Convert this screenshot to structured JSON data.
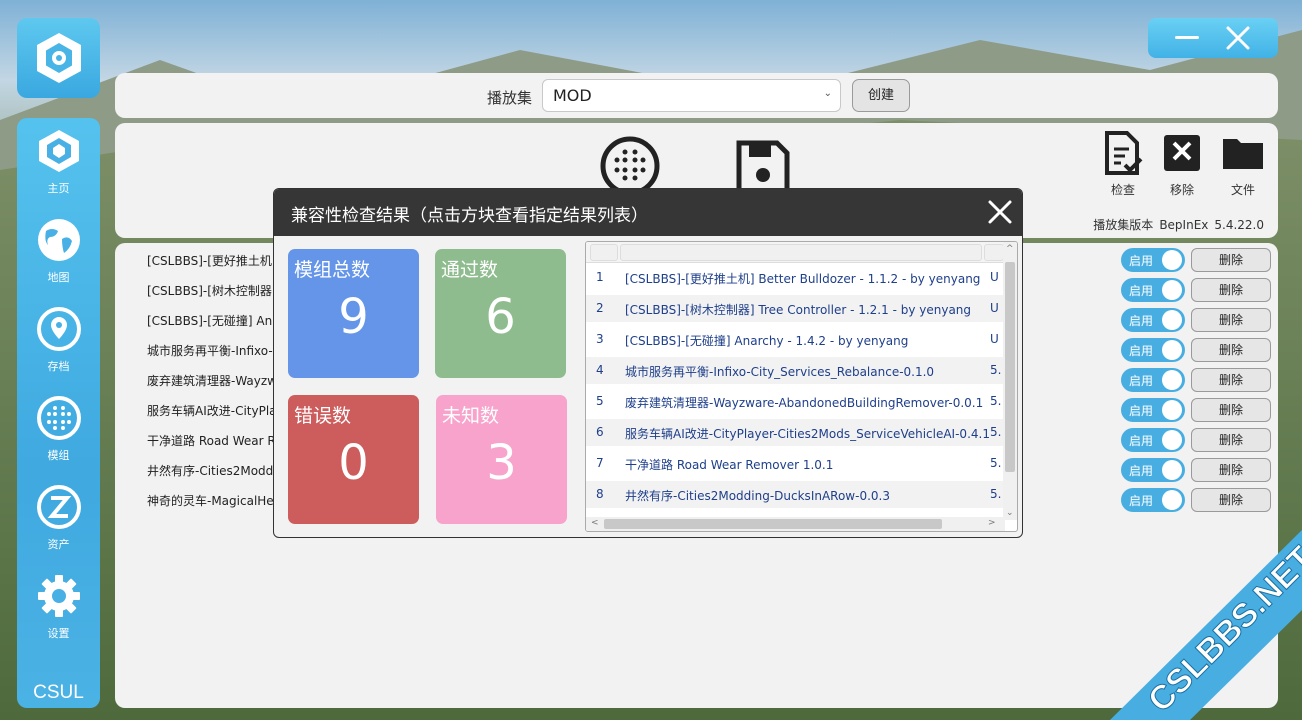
{
  "brand": "CSUL",
  "sidebar": {
    "items": [
      {
        "label": "主页",
        "icon": "home-hex-icon"
      },
      {
        "label": "地图",
        "icon": "globe-icon"
      },
      {
        "label": "存档",
        "icon": "location-pin-icon"
      },
      {
        "label": "模组",
        "icon": "dots-grid-icon"
      },
      {
        "label": "资产",
        "icon": "z-circle-icon"
      },
      {
        "label": "设置",
        "icon": "gear-icon"
      }
    ]
  },
  "topbar": {
    "playset_label": "播放集",
    "playset_value": "MOD",
    "create_label": "创建"
  },
  "tools": {
    "check_label": "检查",
    "remove_label": "移除",
    "file_label": "文件",
    "version_label": "播放集版本",
    "loader": "BepInEx",
    "version": "5.4.22.0"
  },
  "mods": [
    "[CSLBBS]-[更好推土机]",
    "[CSLBBS]-[树木控制器]",
    "[CSLBBS]-[无碰撞] Ana",
    "城市服务再平衡-Infixo-",
    "废弃建筑清理器-Wayzw",
    "服务车辆AI改进-CityPla",
    "干净道路 Road Wear R",
    "井然有序-Cities2Modd",
    "神奇的灵车-MagicalHe"
  ],
  "row_controls": {
    "enable_label": "启用",
    "delete_label": "删除"
  },
  "modal": {
    "title": "兼容性检查结果（点击方块查看指定结果列表）",
    "stats": {
      "total_label": "模组总数",
      "total_value": "9",
      "pass_label": "通过数",
      "pass_value": "6",
      "error_label": "错误数",
      "error_value": "0",
      "unknown_label": "未知数",
      "unknown_value": "3"
    },
    "results": [
      {
        "index": "1",
        "name": "[CSLBBS]-[更好推土机] Better Bulldozer - 1.1.2 - by yenyang",
        "extra": "U"
      },
      {
        "index": "2",
        "name": "[CSLBBS]-[树木控制器] Tree Controller - 1.2.1 - by yenyang",
        "extra": "U"
      },
      {
        "index": "3",
        "name": "[CSLBBS]-[无碰撞] Anarchy - 1.4.2 - by yenyang",
        "extra": "U"
      },
      {
        "index": "4",
        "name": "城市服务再平衡-Infixo-City_Services_Rebalance-0.1.0",
        "extra": "5."
      },
      {
        "index": "5",
        "name": "废弃建筑清理器-Wayzware-AbandonedBuildingRemover-0.0.1",
        "extra": "5."
      },
      {
        "index": "6",
        "name": "服务车辆AI改进-CityPlayer-Cities2Mods_ServiceVehicleAI-0.4.1",
        "extra": "5."
      },
      {
        "index": "7",
        "name": "干净道路 Road Wear Remover 1.0.1",
        "extra": "5."
      },
      {
        "index": "8",
        "name": "井然有序-Cities2Modding-DucksInARow-0.0.3",
        "extra": "5."
      }
    ]
  },
  "watermark": "CSLBBS.NET",
  "colors": {
    "accent": "#48aee2",
    "stat_total": "#6495e8",
    "stat_pass": "#8fbc8f",
    "stat_error": "#cd5c5c",
    "stat_unknown": "#f7a3cc"
  }
}
